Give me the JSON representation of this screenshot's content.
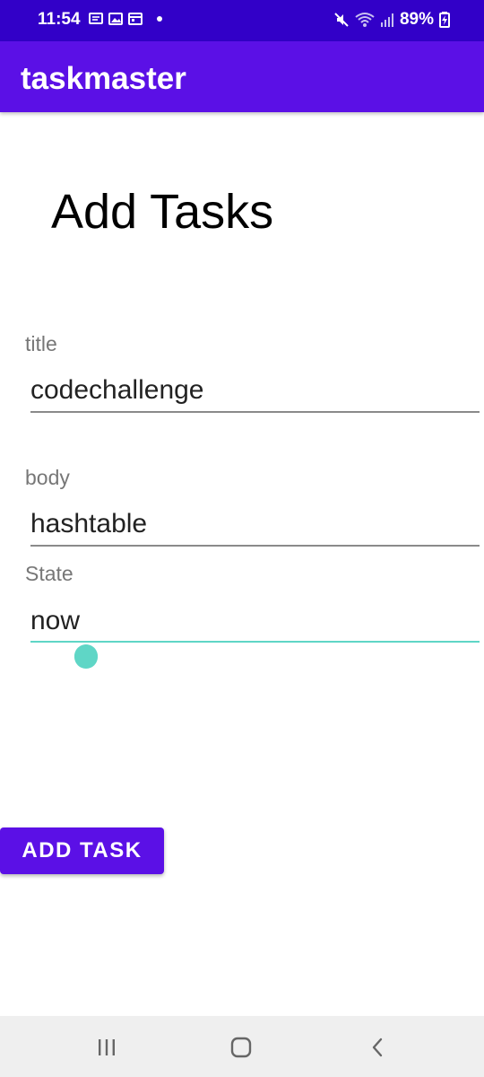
{
  "status_bar": {
    "time": "11:54",
    "battery": "89%",
    "notification_icons": [
      "message-icon",
      "image-icon",
      "calendar-icon"
    ],
    "right_icons": [
      "mute-icon",
      "wifi-icon",
      "signal-icon",
      "battery-charging-icon"
    ]
  },
  "app_bar": {
    "title": "taskmaster",
    "color": "#5b10e6"
  },
  "form": {
    "heading": "Add Tasks",
    "fields": [
      {
        "label": "title",
        "value": "codechallenge"
      },
      {
        "label": "body",
        "value": "hashtable"
      },
      {
        "label": "State",
        "value": "now"
      }
    ],
    "focused_field": "State",
    "accent_color": "#5fd6c6"
  },
  "actions": {
    "add_task_label": "ADD TASK"
  },
  "nav_bar": {
    "buttons": [
      "recent-apps-icon",
      "home-icon",
      "back-icon"
    ]
  }
}
